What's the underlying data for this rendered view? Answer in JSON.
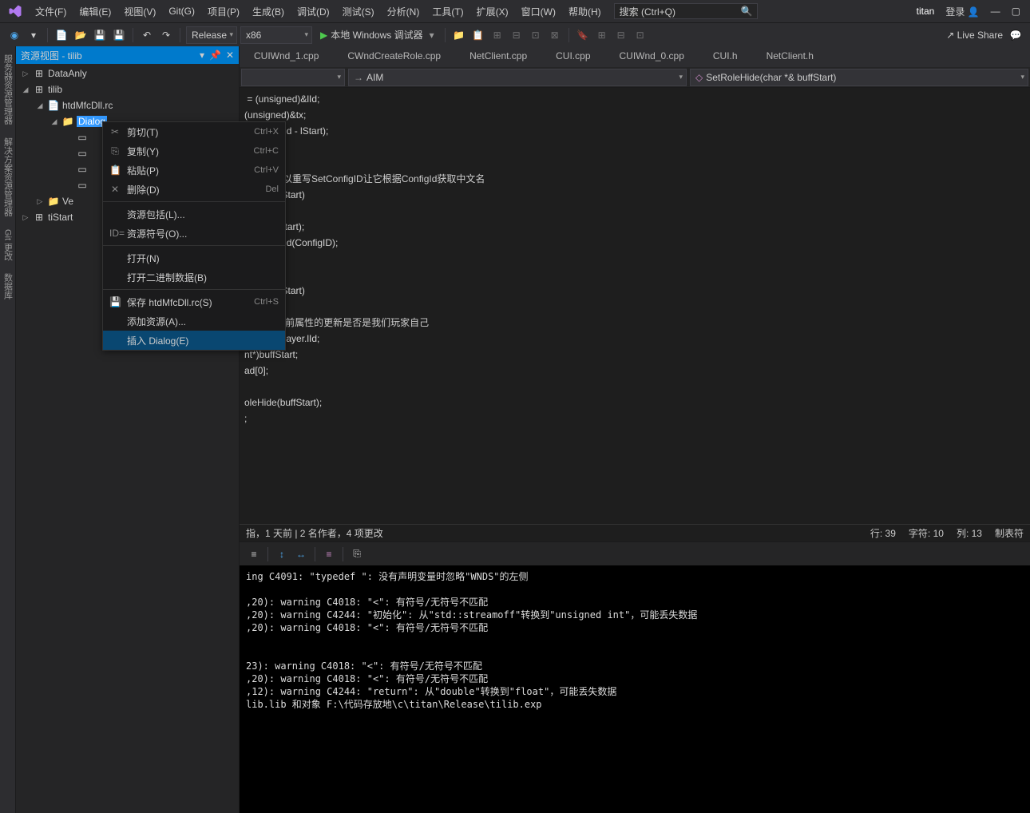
{
  "menu": {
    "items": [
      "文件(F)",
      "编辑(E)",
      "视图(V)",
      "Git(G)",
      "项目(P)",
      "生成(B)",
      "调试(D)",
      "测试(S)",
      "分析(N)",
      "工具(T)",
      "扩展(X)",
      "窗口(W)",
      "帮助(H)"
    ],
    "search_ph": "搜索 (Ctrl+Q)",
    "solution": "titan",
    "login": "登录"
  },
  "toolbar": {
    "config": "Release",
    "platform": "x86",
    "run": "本地 Windows 调试器",
    "liveshare": "Live Share"
  },
  "vtabs": [
    "服务器资源管理器",
    "解决方案资源管理器",
    "Git 更改",
    "数据库"
  ],
  "panel": {
    "title": "资源视图 - tilib",
    "tree": [
      {
        "d": 0,
        "exp": "▷",
        "icon": "db",
        "label": "DataAnly"
      },
      {
        "d": 0,
        "exp": "◢",
        "icon": "db",
        "label": "tilib"
      },
      {
        "d": 1,
        "exp": "◢",
        "icon": "rc",
        "label": "htdMfcDll.rc"
      },
      {
        "d": 2,
        "exp": "◢",
        "icon": "folder",
        "label": "Dialog",
        "sel": true
      },
      {
        "d": 3,
        "exp": "",
        "icon": "dlg",
        "label": ""
      },
      {
        "d": 3,
        "exp": "",
        "icon": "dlg",
        "label": ""
      },
      {
        "d": 3,
        "exp": "",
        "icon": "dlg",
        "label": ""
      },
      {
        "d": 3,
        "exp": "",
        "icon": "dlg",
        "label": ""
      },
      {
        "d": 1,
        "exp": "▷",
        "icon": "folder",
        "label": "Ve"
      },
      {
        "d": 0,
        "exp": "▷",
        "icon": "db",
        "label": "tiStart"
      }
    ]
  },
  "ctx": [
    {
      "icon": "✂",
      "label": "剪切(T)",
      "short": "Ctrl+X",
      "dis": true
    },
    {
      "icon": "⎘",
      "label": "复制(Y)",
      "short": "Ctrl+C",
      "dis": true
    },
    {
      "icon": "📋",
      "label": "粘贴(P)",
      "short": "Ctrl+V",
      "dis": true
    },
    {
      "icon": "✕",
      "label": "删除(D)",
      "short": "Del",
      "dis": true
    },
    {
      "sep": true
    },
    {
      "label": "资源包括(L)..."
    },
    {
      "icon": "ID=",
      "label": "资源符号(O)..."
    },
    {
      "sep": true
    },
    {
      "label": "打开(N)",
      "dis": true
    },
    {
      "label": "打开二进制数据(B)",
      "dis": true
    },
    {
      "sep": true
    },
    {
      "icon": "💾",
      "label": "保存 htdMfcDll.rc(S)",
      "short": "Ctrl+S",
      "dis": true
    },
    {
      "label": "添加资源(A)..."
    },
    {
      "label": "插入 Dialog(E)",
      "hover": true
    }
  ],
  "tabs": [
    "CUIWnd_1.cpp",
    "CWndCreateRole.cpp",
    "NetClient.cpp",
    "CUI.cpp",
    "CUIWnd_0.cpp",
    "CUI.h",
    "NetClient.h"
  ],
  "nav": {
    "scope": "",
    "func": "AIM",
    "member": "SetRoleHide(char *& buffStart)"
  },
  "code_lines": [
    " = <kw>(unsigned)</kw>&lId;",
    "<kw>(unsigned)</kw>&tx;",
    "fStart, <pl>lEnd - lStart</pl>);",
    "",
    "",
    "<cm>名字，所以重写SetConfigID让它根据ConfigId获取中文名</cm>",
    "<fn>ar</fn>*& buffStart)",
    "",
    "<fn>gID</fn>(buffStart);",
    "<fn>adTextById</fn>(ConfigID);",
    "",
    "",
    "<fn>ar</fn>*& buffStart)",
    "",
    "<cm>|来判断当前属性的更新是否是我们玩家自己</cm>",
    "Client->Player.lId;",
    "<kw>nt</kw>*)buffStart;",
    "ad[<num>0</num>];",
    "",
    "<fn>oleHide</fn>(buffStart);",
    ";"
  ],
  "status": {
    "left": "指，1 天前 | 2 名作者，4 项更改",
    "line": "行: 39",
    "char": "字符: 10",
    "col": "列: 13",
    "tab": "制表符"
  },
  "output": [
    "ing C4091: \"typedef \": 没有声明变量时忽略\"WNDS\"的左侧",
    "",
    ",20): warning C4018: \"<\": 有符号/无符号不匹配",
    ",20): warning C4244: \"初始化\": 从\"std::streamoff\"转换到\"unsigned int\"，可能丢失数据",
    ",20): warning C4018: \"<\": 有符号/无符号不匹配",
    "",
    "",
    "23): warning C4018: \"<\": 有符号/无符号不匹配",
    ",20): warning C4018: \"<\": 有符号/无符号不匹配",
    ",12): warning C4244: \"return\": 从\"double\"转换到\"float\"，可能丢失数据",
    "lib.lib 和对象 F:\\代码存放地\\c\\titan\\Release\\tilib.exp"
  ]
}
